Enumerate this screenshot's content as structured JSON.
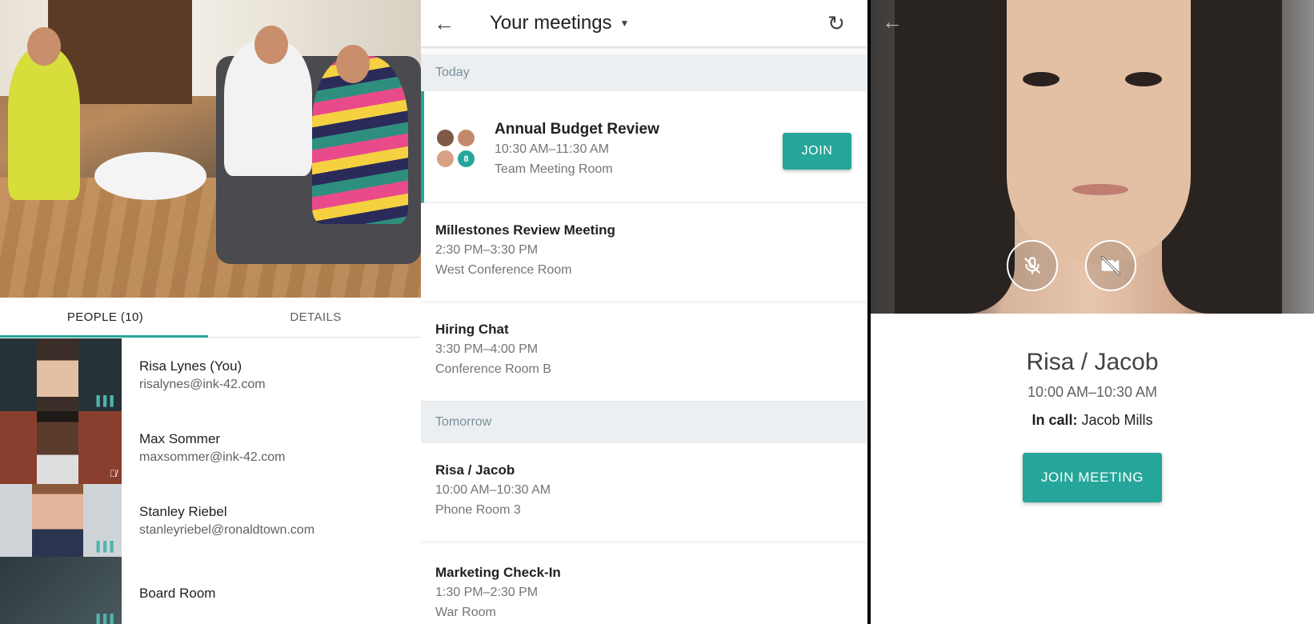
{
  "left": {
    "tabs": [
      {
        "label": "PEOPLE (10)"
      },
      {
        "label": "DETAILS"
      }
    ],
    "people": [
      {
        "name": "Risa Lynes (You)",
        "email": "risalynes@ink-42.com",
        "status_icon": "audio-level-icon"
      },
      {
        "name": "Max Sommer",
        "email": "maxsommer@ink-42.com",
        "status_icon": "mic-off-icon"
      },
      {
        "name": "Stanley Riebel",
        "email": "stanleyriebel@ronaldtown.com",
        "status_icon": "audio-level-icon"
      },
      {
        "name": "Board Room",
        "email": "",
        "status_icon": "audio-level-icon"
      }
    ]
  },
  "middle": {
    "title": "Your meetings",
    "sections": {
      "today": "Today",
      "tomorrow": "Tomorrow"
    },
    "meetings": [
      {
        "title": "Annual Budget Review",
        "time": "10:30 AM–11:30 AM",
        "room": "Team Meeting Room",
        "attendee_count": "8",
        "join_label": "JOIN"
      },
      {
        "title": "Millestones Review Meeting",
        "time": "2:30 PM–3:30 PM",
        "room": "West Conference Room"
      },
      {
        "title": "Hiring Chat",
        "time": "3:30 PM–4:00 PM",
        "room": "Conference Room B"
      },
      {
        "title": "Risa / Jacob",
        "time": "10:00 AM–10:30 AM",
        "room": "Phone Room 3"
      },
      {
        "title": "Marketing Check-In",
        "time": "1:30 PM–2:30 PM",
        "room": "War Room"
      }
    ]
  },
  "right": {
    "meeting_title": "Risa / Jacob",
    "meeting_time": "10:00 AM–10:30 AM",
    "in_call_label": "In call:",
    "in_call_name": "Jacob Mills",
    "join_label": "JOIN MEETING"
  },
  "colors": {
    "accent": "#26a69a",
    "section_bg": "#eceff1"
  }
}
